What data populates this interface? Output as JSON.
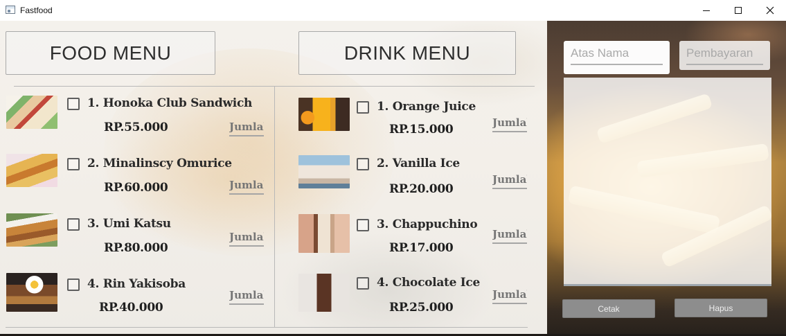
{
  "window": {
    "title": "Fastfood",
    "controls": {
      "minimize": "minimize-icon",
      "maximize": "maximize-icon",
      "close": "close-icon"
    }
  },
  "food_menu": {
    "header": "FOOD MENU",
    "items": [
      {
        "name": "1. Honoka Club Sandwich",
        "price": "RP.55.000",
        "quantity_placeholder": "Jumlah",
        "image": "sandwich-image"
      },
      {
        "name": "2. Minalinscy Omurice",
        "price": "RP.60.000",
        "quantity_placeholder": "Jumlah",
        "image": "omurice-image"
      },
      {
        "name": "3. Umi Katsu",
        "price": "RP.80.000",
        "quantity_placeholder": "Jumlah",
        "image": "katsu-image"
      },
      {
        "name": "4. Rin Yakisoba",
        "price": "RP.40.000",
        "quantity_placeholder": "Jumlah",
        "image": "yakisoba-image"
      }
    ]
  },
  "drink_menu": {
    "header": "DRINK MENU",
    "items": [
      {
        "name": "1. Orange Juice",
        "price": "RP.15.000",
        "quantity_placeholder": "Jumlah",
        "image": "orange-juice-image"
      },
      {
        "name": "2. Vanilla Ice",
        "price": "RP.20.000",
        "quantity_placeholder": "Jumlah",
        "image": "vanilla-ice-image"
      },
      {
        "name": "3. Chappuchino",
        "price": "RP.17.000",
        "quantity_placeholder": "Jumlah",
        "image": "cappuccino-image"
      },
      {
        "name": "4. Chocolate Ice",
        "price": "RP.25.000",
        "quantity_placeholder": "Jumlah",
        "image": "chocolate-ice-image"
      }
    ]
  },
  "order_panel": {
    "name_placeholder": "Atas Nama",
    "payment_placeholder": "Pembayaran",
    "receipt_text": "",
    "print_label": "Cetak",
    "clear_label": "Hapus"
  },
  "colors": {
    "header_text": "#2e2e2e",
    "jumlah_text": "#a3a3a3",
    "button_bg": "#8d8d8d",
    "button_text": "#eeeeee"
  }
}
